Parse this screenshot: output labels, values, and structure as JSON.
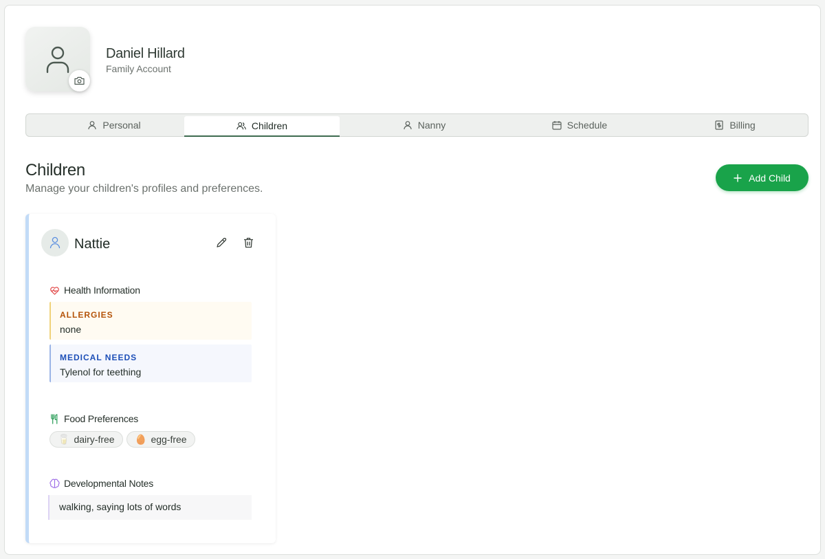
{
  "profile": {
    "name": "Daniel Hillard",
    "account_type": "Family Account"
  },
  "tabs": [
    {
      "label": "Personal",
      "icon": "user-icon"
    },
    {
      "label": "Children",
      "icon": "users-icon",
      "active": true
    },
    {
      "label": "Nanny",
      "icon": "user-icon"
    },
    {
      "label": "Schedule",
      "icon": "calendar-icon"
    },
    {
      "label": "Billing",
      "icon": "receipt-icon"
    }
  ],
  "section": {
    "title": "Children",
    "subtitle": "Manage your children's profiles and preferences.",
    "add_button": "Add Child"
  },
  "child": {
    "name": "Nattie",
    "health_heading": "Health Information",
    "allergies_label": "ALLERGIES",
    "allergies_value": "none",
    "medical_label": "MEDICAL NEEDS",
    "medical_value": "Tylenol for teething",
    "food_heading": "Food Preferences",
    "food_chips": [
      {
        "emoji": "🥛",
        "label": "dairy-free"
      },
      {
        "emoji": "🥚",
        "label": "egg-free"
      }
    ],
    "dev_heading": "Developmental Notes",
    "dev_value": "walking, saying lots of words"
  },
  "colors": {
    "accent_green": "#19a34a",
    "card_border": "#c2dbf7",
    "allergy_label": "#b45309",
    "medical_label": "#1d4fb8"
  }
}
